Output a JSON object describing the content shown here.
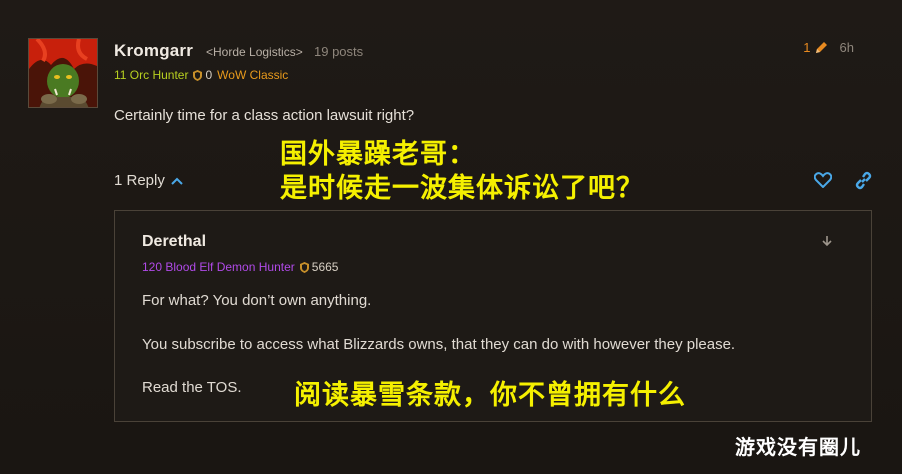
{
  "post": {
    "author": "Kromgarr",
    "guild": "<Horde Logistics>",
    "post_count": "19 posts",
    "class_info": "11 Orc Hunter",
    "achievements": "0",
    "game": "WoW Classic",
    "edit_count": "1",
    "time": "6h",
    "body": "Certainly time for a class action lawsuit right?",
    "replies_label": "1 Reply"
  },
  "caption_top": {
    "line1": "国外暴躁老哥：",
    "line2": "是时候走一波集体诉讼了吧？"
  },
  "reply": {
    "author": "Derethal",
    "class_info": "120 Blood Elf Demon Hunter",
    "achievements": "5665",
    "line1": "For what? You don’t own anything.",
    "line2": "You subscribe to access what Blizzards owns, that they can do with however they please.",
    "line3": "Read the TOS."
  },
  "caption_bottom": "阅读暴雪条款，你不曾拥有什么",
  "watermark": "游戏没有圈儿",
  "colors": {
    "class_hunter": "#b8d020",
    "class_demon_hunter": "#b04ae8",
    "game_tag": "#e89a1c",
    "accent_blue": "#4aa8e8",
    "caption": "#f5f000"
  },
  "icons": [
    "avatar-orc",
    "achievement-shield-icon",
    "edit-pencil-icon",
    "chevron-up-icon",
    "heart-icon",
    "link-icon",
    "arrow-down-icon"
  ]
}
